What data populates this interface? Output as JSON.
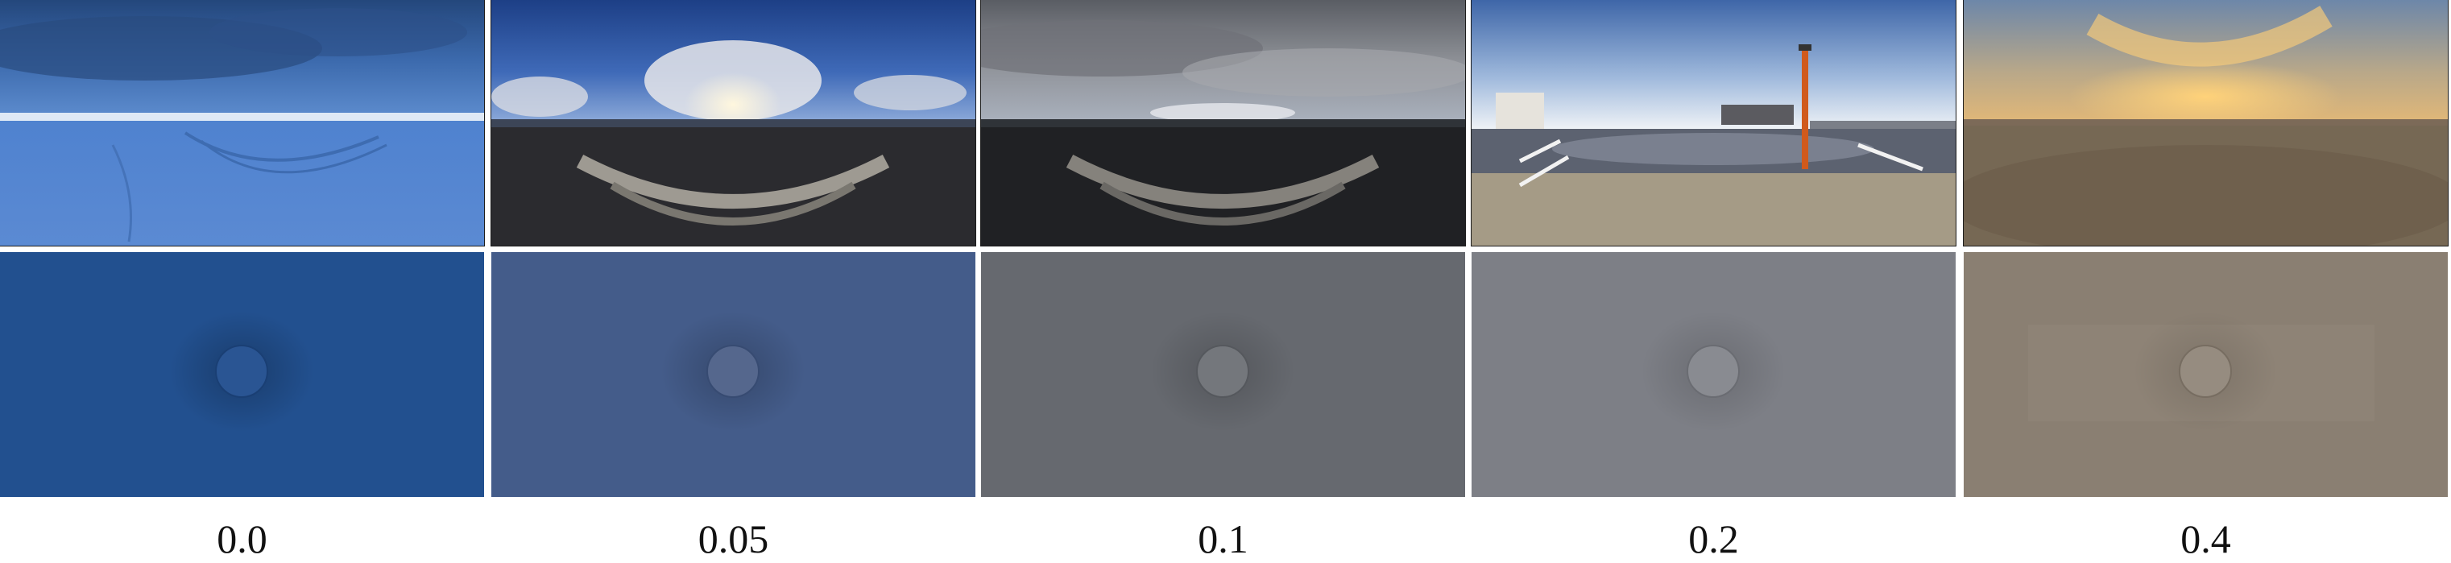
{
  "columns": [
    {
      "label": "0.0",
      "render_color": "#22508f"
    },
    {
      "label": "0.05",
      "render_color": "#445c8a"
    },
    {
      "label": "0.1",
      "render_color": "#66696f"
    },
    {
      "label": "0.2",
      "render_color": "#7d7f86"
    },
    {
      "label": "0.4",
      "render_color": "#8a7f72"
    }
  ]
}
